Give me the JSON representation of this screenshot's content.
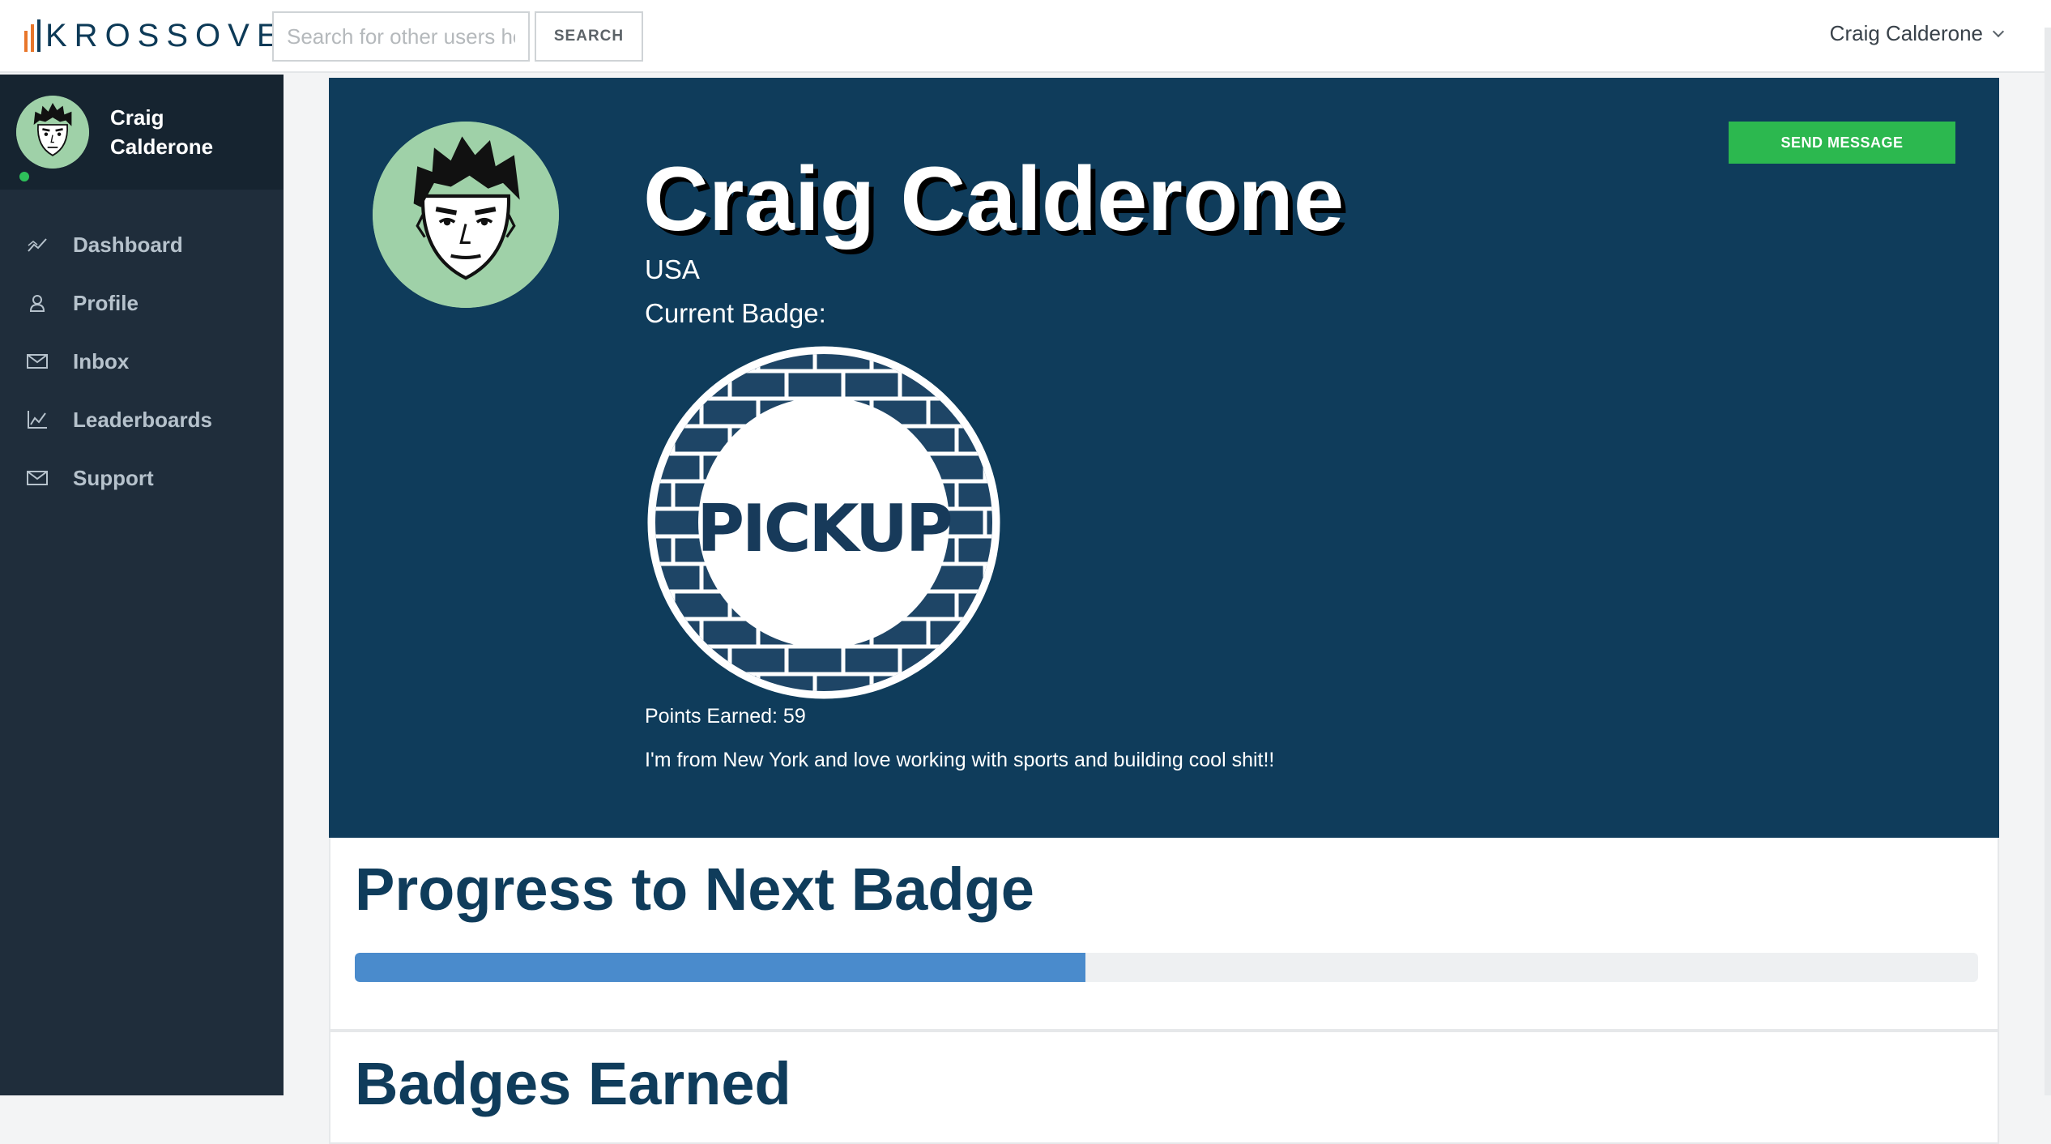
{
  "app": {
    "logo_text": "KROSSOVER",
    "brand_colors": {
      "navy": "#0f3c5b",
      "green": "#2cb84f",
      "blue": "#4a8bcc",
      "orange": "#e8762b",
      "red": "#d9363e"
    }
  },
  "header": {
    "search_placeholder": "Search for other users here",
    "search_button": "SEARCH",
    "user_name": "Craig Calderone",
    "user_menu_icon": "chevron-down-icon"
  },
  "sidebar": {
    "user_name": "Craig Calderone",
    "status": "online",
    "items": [
      {
        "label": "Dashboard",
        "icon": "trend-line-icon"
      },
      {
        "label": "Profile",
        "icon": "user-icon"
      },
      {
        "label": "Inbox",
        "icon": "envelope-icon"
      },
      {
        "label": "Leaderboards",
        "icon": "line-chart-icon"
      },
      {
        "label": "Support",
        "icon": "envelope-icon"
      }
    ]
  },
  "profile": {
    "name": "Craig Calderone",
    "country": "USA",
    "current_badge_label": "Current Badge:",
    "badge_text": "PICKUP",
    "points_earned": "Points Earned: 59",
    "bio": "I'm from New York and love working with sports and building cool shit!!",
    "send_message_label": "SEND MESSAGE"
  },
  "progress": {
    "title": "Progress to Next Badge",
    "percent": 45
  },
  "badges": {
    "title": "Badges Earned"
  }
}
